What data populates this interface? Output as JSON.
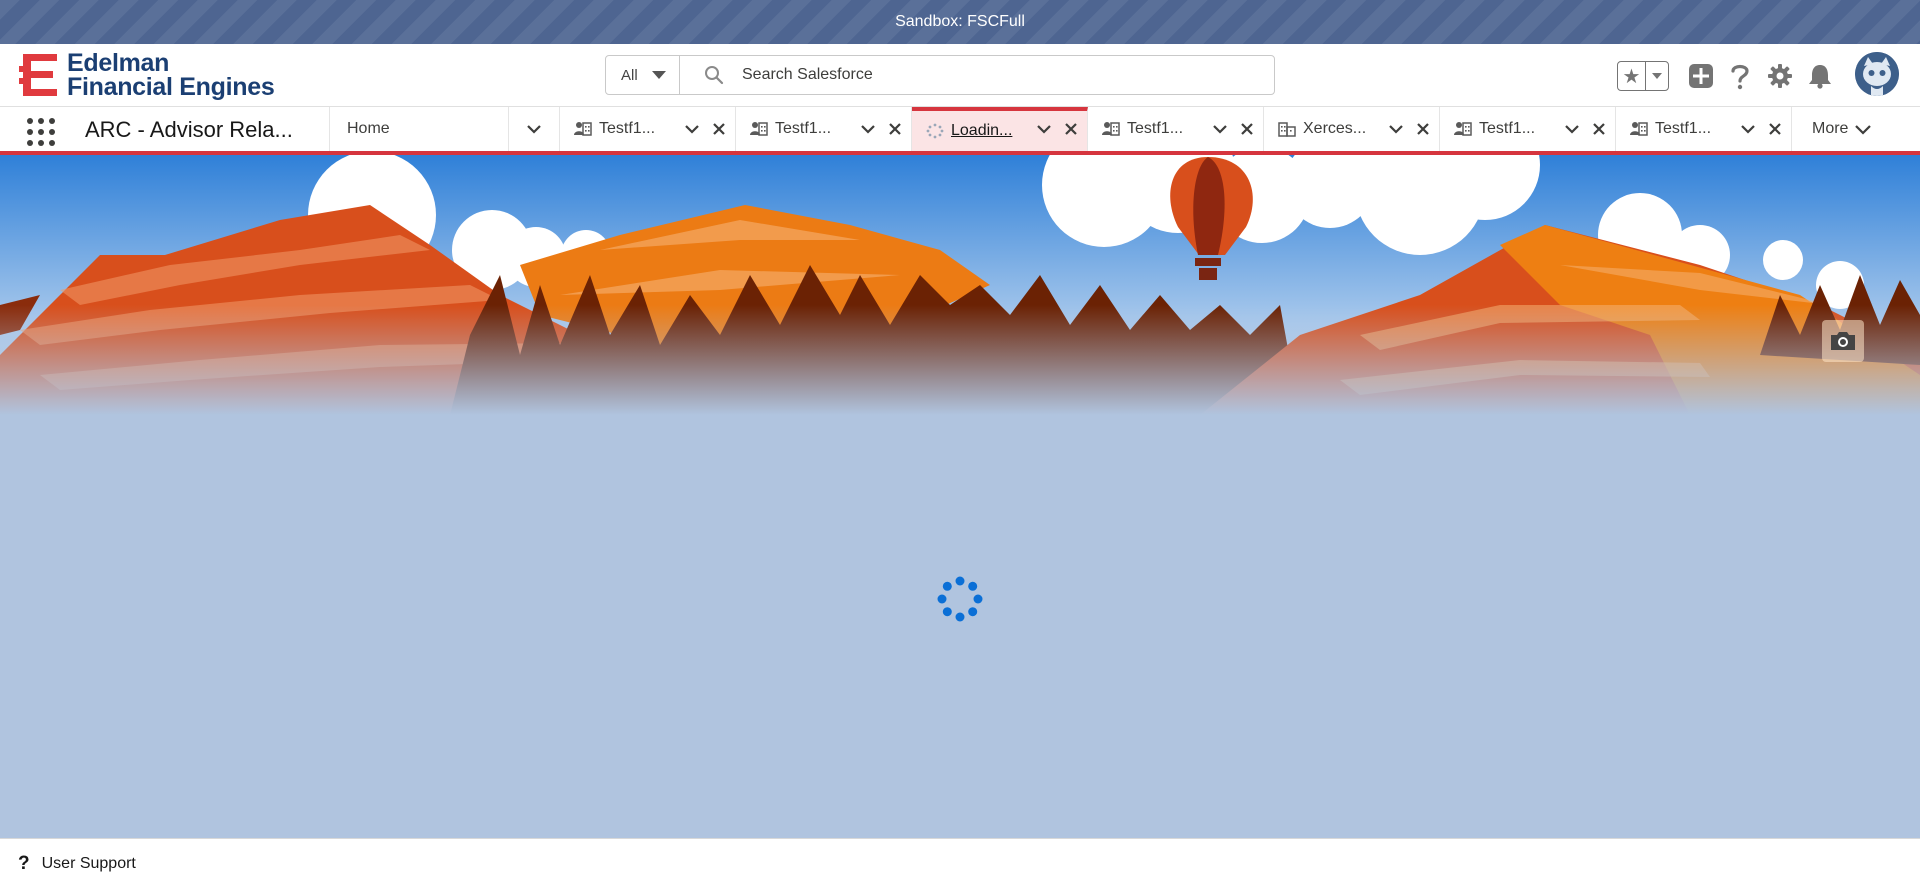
{
  "sandbox": {
    "label": "Sandbox: FSCFull"
  },
  "header": {
    "logo": {
      "line1": "Edelman",
      "line2": "Financial Engines",
      "brand_color": "#1b3f73",
      "mark_color": "#e03a3e"
    },
    "search": {
      "scope": "All",
      "placeholder": "Search Salesforce"
    },
    "icons": [
      "favorites-star-icon",
      "add-icon",
      "help-icon",
      "setup-gear-icon",
      "notifications-bell-icon",
      "user-avatar"
    ]
  },
  "nav": {
    "app_name": "ARC - Advisor Rela...",
    "home": "Home",
    "tabs": [
      {
        "label": "Testf1...",
        "icon": "person-account-icon",
        "active": false
      },
      {
        "label": "Testf1...",
        "icon": "person-account-icon",
        "active": false
      },
      {
        "label": "Loadin...",
        "icon": "loading-spinner-icon",
        "active": true
      },
      {
        "label": "Testf1...",
        "icon": "person-account-icon",
        "active": false
      },
      {
        "label": "Xerces...",
        "icon": "business-account-icon",
        "active": false
      },
      {
        "label": "Testf1...",
        "icon": "person-account-icon",
        "active": false
      },
      {
        "label": "Testf1...",
        "icon": "person-account-icon",
        "active": false
      }
    ],
    "more": "More",
    "accent_color": "#d6353e"
  },
  "content": {
    "status": "loading",
    "spinner_color": "#0b6fd6"
  },
  "utility_bar": {
    "help_glyph": "?",
    "label": "User Support"
  }
}
